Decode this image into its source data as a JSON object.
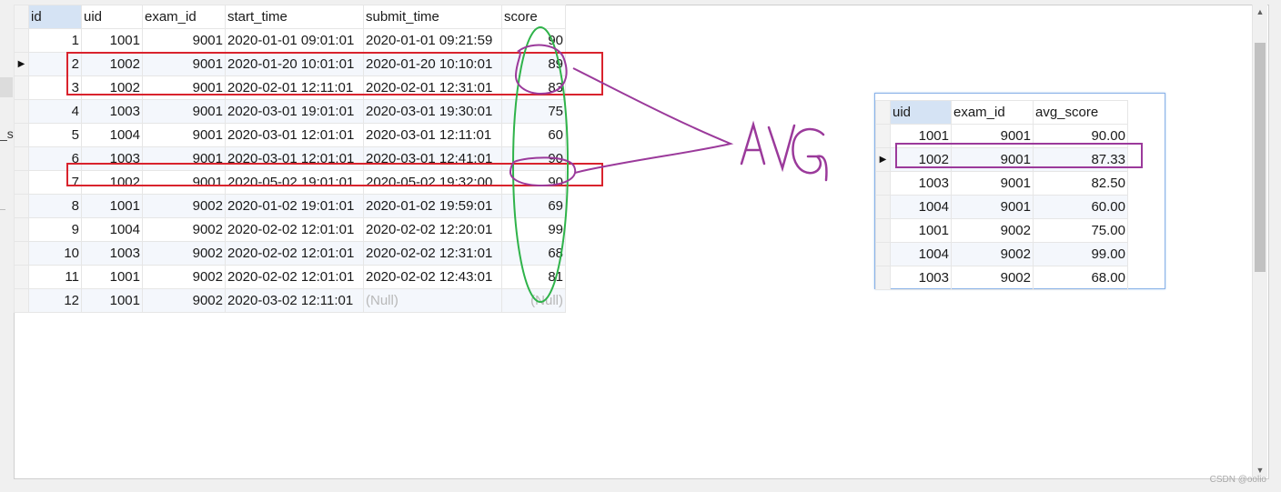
{
  "query_result": {
    "columns": [
      "id",
      "uid",
      "exam_id",
      "start_time",
      "submit_time",
      "score"
    ],
    "rows": [
      [
        "1",
        "1001",
        "9001",
        "2020-01-01 09:01:01",
        "2020-01-01 09:21:59",
        "90"
      ],
      [
        "2",
        "1002",
        "9001",
        "2020-01-20 10:01:01",
        "2020-01-20 10:10:01",
        "89"
      ],
      [
        "3",
        "1002",
        "9001",
        "2020-02-01 12:11:01",
        "2020-02-01 12:31:01",
        "83"
      ],
      [
        "4",
        "1003",
        "9001",
        "2020-03-01 19:01:01",
        "2020-03-01 19:30:01",
        "75"
      ],
      [
        "5",
        "1004",
        "9001",
        "2020-03-01 12:01:01",
        "2020-03-01 12:11:01",
        "60"
      ],
      [
        "6",
        "1003",
        "9001",
        "2020-03-01 12:01:01",
        "2020-03-01 12:41:01",
        "90"
      ],
      [
        "7",
        "1002",
        "9001",
        "2020-05-02 19:01:01",
        "2020-05-02 19:32:00",
        "90"
      ],
      [
        "8",
        "1001",
        "9002",
        "2020-01-02 19:01:01",
        "2020-01-02 19:59:01",
        "69"
      ],
      [
        "9",
        "1004",
        "9002",
        "2020-02-02 12:01:01",
        "2020-02-02 12:20:01",
        "99"
      ],
      [
        "10",
        "1003",
        "9002",
        "2020-02-02 12:01:01",
        "2020-02-02 12:31:01",
        "68"
      ],
      [
        "11",
        "1001",
        "9002",
        "2020-02-02 12:01:01",
        "2020-02-02 12:43:01",
        "81"
      ],
      [
        "12",
        "1001",
        "9002",
        "2020-03-02 12:11:01",
        "(Null)",
        "(Null)"
      ]
    ],
    "current_row": 1,
    "selected_column": "id"
  },
  "avg_result": {
    "columns": [
      "uid",
      "exam_id",
      "avg_score"
    ],
    "rows": [
      [
        "1001",
        "9001",
        "90.00"
      ],
      [
        "1002",
        "9001",
        "87.33"
      ],
      [
        "1003",
        "9001",
        "82.50"
      ],
      [
        "1004",
        "9001",
        "60.00"
      ],
      [
        "1001",
        "9002",
        "75.00"
      ],
      [
        "1004",
        "9002",
        "99.00"
      ],
      [
        "1003",
        "9002",
        "68.00"
      ]
    ],
    "current_row": 1,
    "selected_column": "uid"
  },
  "annotations": {
    "handwritten_text": "AVG",
    "red_box_color": "#d9232d",
    "green_ellipse_color": "#2fb34a",
    "purple_color": "#9b3a9b"
  },
  "side_fragment_text": "_sc",
  "watermark": "CSDN @oolio",
  "colors": {
    "grid_border": "#e6e6e6",
    "alt_row": "#f4f7fc",
    "selected_header": "#d5e3f4",
    "null_text": "#b8b8b8",
    "panel_border": "#8bb3e8"
  }
}
